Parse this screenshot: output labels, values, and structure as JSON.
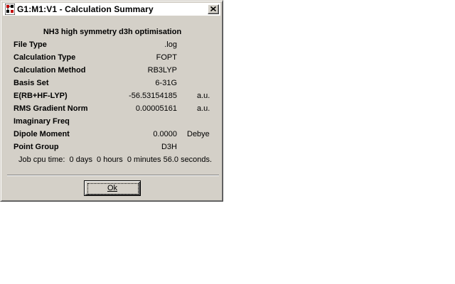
{
  "window": {
    "title": "G1:M1:V1 - Calculation Summary",
    "icon": "gaussview-app-icon",
    "close_icon": "close-icon"
  },
  "summary": {
    "heading": "NH3 high symmetry d3h optimisation",
    "rows": [
      {
        "label": "File Type",
        "value": ".log",
        "unit": ""
      },
      {
        "label": "Calculation Type",
        "value": "FOPT",
        "unit": ""
      },
      {
        "label": "Calculation Method",
        "value": "RB3LYP",
        "unit": ""
      },
      {
        "label": "Basis Set",
        "value": "6-31G",
        "unit": ""
      },
      {
        "label": "E(RB+HF-LYP)",
        "value": "-56.53154185",
        "unit": "a.u."
      },
      {
        "label": "RMS Gradient Norm",
        "value": "0.00005161",
        "unit": "a.u."
      },
      {
        "label": "Imaginary Freq",
        "value": "",
        "unit": ""
      },
      {
        "label": "Dipole Moment",
        "value": "0.0000",
        "unit": "Debye"
      },
      {
        "label": "Point Group",
        "value": "D3H",
        "unit": ""
      }
    ],
    "cpu_time": "Job cpu time:  0 days  0 hours  0 minutes 56.0 seconds."
  },
  "buttons": {
    "ok_label": "Ok"
  }
}
